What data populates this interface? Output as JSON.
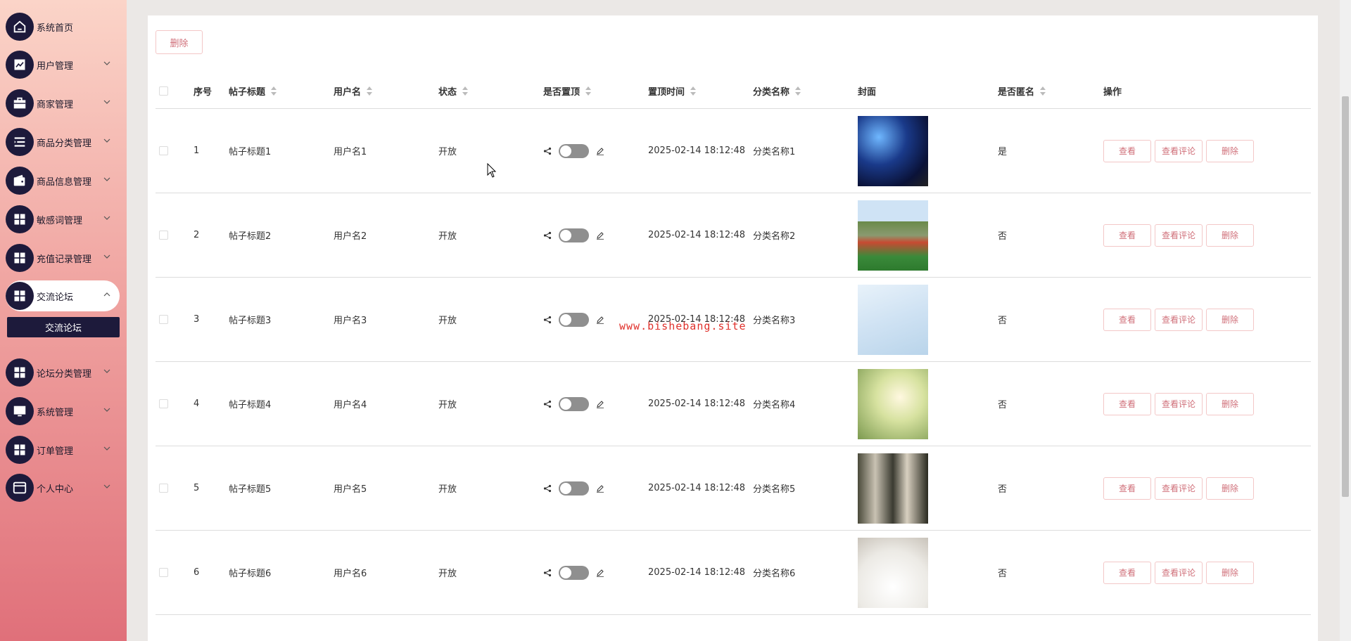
{
  "sidebar": {
    "items": [
      {
        "label": "系统首页",
        "icon": "home-icon"
      },
      {
        "label": "用户管理",
        "icon": "chart-icon"
      },
      {
        "label": "商家管理",
        "icon": "briefcase-icon"
      },
      {
        "label": "商品分类管理",
        "icon": "list-icon"
      },
      {
        "label": "商品信息管理",
        "icon": "wallet-icon"
      },
      {
        "label": "敏感词管理",
        "icon": "grid-icon"
      },
      {
        "label": "充值记录管理",
        "icon": "grid-icon"
      },
      {
        "label": "交流论坛",
        "icon": "grid-icon"
      },
      {
        "label": "论坛分类管理",
        "icon": "grid-icon"
      },
      {
        "label": "系统管理",
        "icon": "monitor-icon"
      },
      {
        "label": "订单管理",
        "icon": "grid-icon"
      },
      {
        "label": "个人中心",
        "icon": "window-icon"
      }
    ],
    "submenu_label": "交流论坛"
  },
  "toolbar": {
    "delete_label": "删除"
  },
  "table": {
    "headers": {
      "index": "序号",
      "title": "帖子标题",
      "username": "用户名",
      "status": "状态",
      "pinned": "是否置顶",
      "pin_time": "置顶时间",
      "category": "分类名称",
      "cover": "封面",
      "anonymous": "是否匿名",
      "actions": "操作"
    },
    "rows": [
      {
        "index": "1",
        "title": "帖子标题1",
        "username": "用户名1",
        "status": "开放",
        "pin_time": "2025-02-14 18:12:48",
        "category": "分类名称1",
        "anonymous": "是",
        "cover": "starry-night-image"
      },
      {
        "index": "2",
        "title": "帖子标题2",
        "username": "用户名2",
        "status": "开放",
        "pin_time": "2025-02-14 18:12:48",
        "category": "分类名称2",
        "anonymous": "否",
        "cover": "running-track-image"
      },
      {
        "index": "3",
        "title": "帖子标题3",
        "username": "用户名3",
        "status": "开放",
        "pin_time": "2025-02-14 18:12:48",
        "category": "分类名称3",
        "anonymous": "否",
        "cover": "ice-hockey-image"
      },
      {
        "index": "4",
        "title": "帖子标题4",
        "username": "用户名4",
        "status": "开放",
        "pin_time": "2025-02-14 18:12:48",
        "category": "分类名称4",
        "anonymous": "否",
        "cover": "girl-in-park-image"
      },
      {
        "index": "5",
        "title": "帖子标题5",
        "username": "用户名5",
        "status": "开放",
        "pin_time": "2025-02-14 18:12:48",
        "category": "分类名称5",
        "anonymous": "否",
        "cover": "group-of-people-image"
      },
      {
        "index": "6",
        "title": "帖子标题6",
        "username": "用户名6",
        "status": "开放",
        "pin_time": "2025-02-14 18:12:48",
        "category": "分类名称6",
        "anonymous": "否",
        "cover": "coffee-cup-image"
      }
    ],
    "actions": {
      "view": "查看",
      "view_comments": "查看评论",
      "delete": "删除"
    }
  },
  "watermark": "www.bishebang.site",
  "colors": {
    "sidebar_icon_bg": "#1d1a3b",
    "accent": "#d0707a",
    "button_border": "#f3c7c7"
  }
}
